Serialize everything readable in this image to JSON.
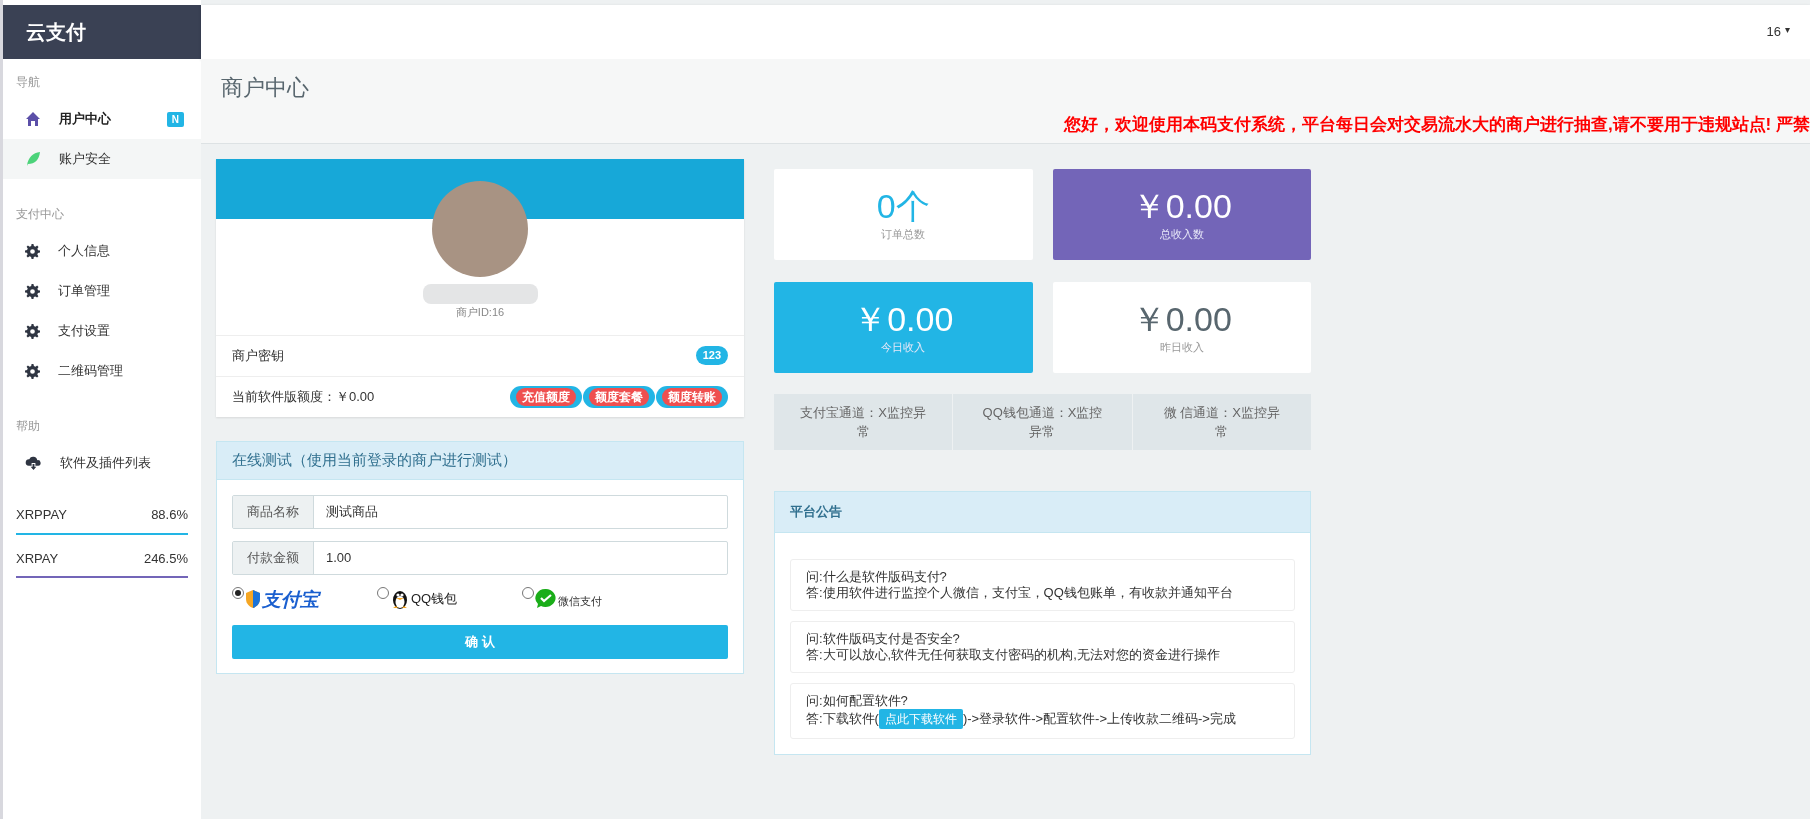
{
  "brand": "云支付",
  "topbar": {
    "user": "16",
    "caret": "▾"
  },
  "sidebar": {
    "sections": [
      {
        "title": "导航",
        "items": [
          {
            "label": "用户中心",
            "kind": "home",
            "selected": true,
            "badge": "N"
          },
          {
            "label": "账户安全",
            "kind": "leaf",
            "selected": false
          }
        ]
      },
      {
        "title": "支付中心",
        "items": [
          {
            "label": "个人信息",
            "kind": "gear",
            "selected": false
          },
          {
            "label": "订单管理",
            "kind": "gear",
            "selected": false
          },
          {
            "label": "支付设置",
            "kind": "gear",
            "selected": false
          },
          {
            "label": "二维码管理",
            "kind": "gear",
            "selected": false
          }
        ]
      },
      {
        "title": "帮助",
        "items": [
          {
            "label": "软件及插件列表",
            "kind": "cloud",
            "selected": false
          }
        ]
      }
    ],
    "meters": [
      {
        "name": "XRPPAY",
        "reading": "88.6%",
        "level": 1,
        "color": "#22b5e5"
      },
      {
        "name": "XRPAY",
        "reading": "246.5%",
        "level": 1,
        "color": "#7365b8"
      }
    ]
  },
  "page_title": "商户中心",
  "notice": "您好，欢迎使用本码支付系统，平台每日会对交易流水大的商户进行抽查,请不要用于违规站点! 严禁",
  "profile": {
    "merchant_id": "商户ID:16",
    "key_label": "商户密钥",
    "key_badge": "123",
    "quota_label": "当前软件版额度：￥0.00",
    "actions": [
      "充值额度",
      "额度套餐",
      "额度转账"
    ]
  },
  "test_panel": {
    "title": "在线测试（使用当前登录的商户进行测试）",
    "fields": [
      {
        "label": "商品名称",
        "value": "测试商品"
      },
      {
        "label": "付款金额",
        "value": "1.00"
      }
    ],
    "methods": [
      {
        "kind": "alipay",
        "label": "支付宝",
        "selected": true
      },
      {
        "kind": "qq",
        "label": "QQ钱包",
        "selected": false
      },
      {
        "kind": "wechat",
        "label": "微信支付",
        "selected": false
      }
    ],
    "submit": "确 认"
  },
  "stats": [
    {
      "value": "0个",
      "label": "订单总数",
      "color": "#ffffff"
    },
    {
      "value": "￥0.00",
      "label": "总收入数",
      "color": "#7365b8"
    },
    {
      "value": "￥0.00",
      "label": "今日收入",
      "color": "#22b5e5"
    },
    {
      "value": "￥0.00",
      "label": "昨日收入",
      "color": "#ffffff"
    }
  ],
  "channels": [
    "支付宝通道：X监控异常",
    "QQ钱包通道：X监控异常",
    "微 信通道：X监控异常"
  ],
  "announcements": {
    "title": "平台公告",
    "items": [
      {
        "question": "问:什么是软件版码支付?",
        "answer": "答:使用软件进行监控个人微信，支付宝，QQ钱包账单，有收款并通知平台"
      },
      {
        "question": "问:软件版码支付是否安全?",
        "answer": "答:大可以放心,软件无任何获取支付密码的机构,无法对您的资金进行操作"
      },
      {
        "question": "问:如何配置软件?",
        "answer_before": "答:下载软件(",
        "link": "点此下载软件",
        "answer_after": ")->登录软件->配置软件->上传收款二维码->完成"
      }
    ]
  }
}
